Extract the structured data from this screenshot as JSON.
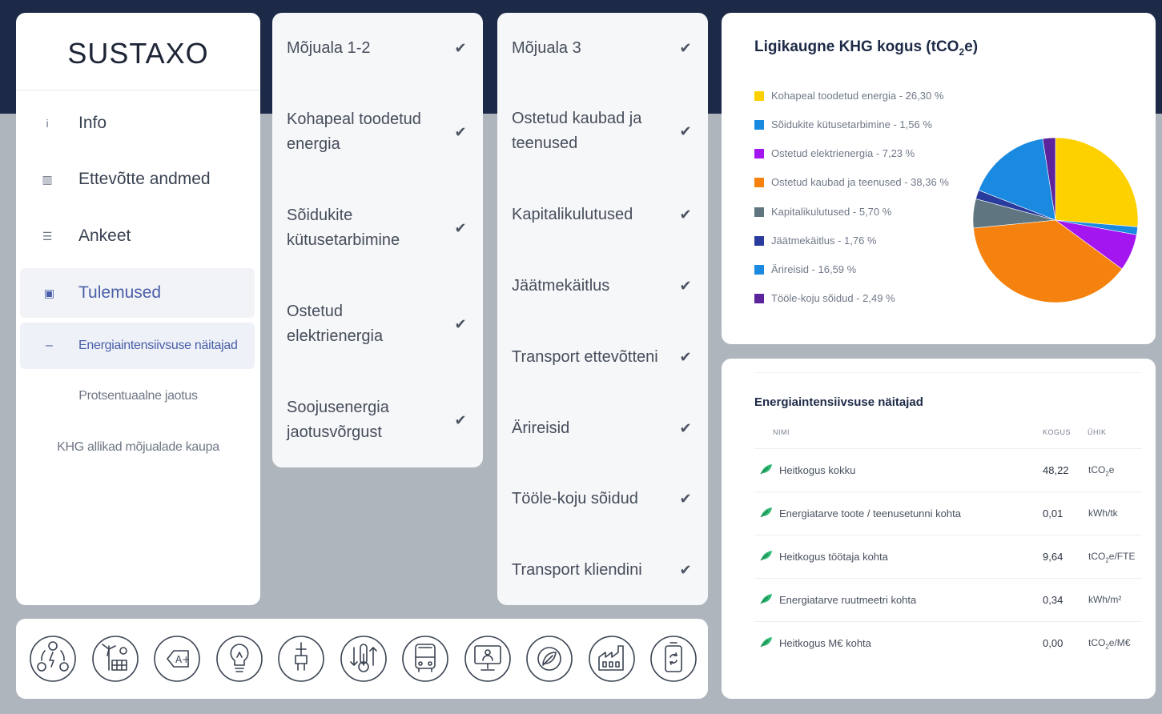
{
  "brand": {
    "logo": "SUSTAXO"
  },
  "sidebar": {
    "items": [
      {
        "label": "Info",
        "icon": "info-icon",
        "glyph": "i"
      },
      {
        "label": "Ettevõtte andmed",
        "icon": "building-icon",
        "glyph": "▥"
      },
      {
        "label": "Ankeet",
        "icon": "list-icon",
        "glyph": "☰"
      },
      {
        "label": "Tulemused",
        "icon": "chart-icon",
        "glyph": "▣"
      }
    ],
    "subitems": [
      {
        "label": "Energiaintensiivsuse näitajad",
        "marker": "–"
      },
      {
        "label": "Protsentuaalne jaotus"
      },
      {
        "label": "KHG allikad mõjualade kaupa"
      }
    ]
  },
  "scope12": {
    "header": "Mõjuala 1-2",
    "items": [
      {
        "line1": "Kohapeal toodetud",
        "line2": "energia"
      },
      {
        "line1": "Sõidukite",
        "line2": "kütusetarbimine"
      },
      {
        "line1": "Ostetud",
        "line2": "elektrienergia"
      },
      {
        "line1": "Soojusenergia",
        "line2": "jaotusvõrgust"
      }
    ]
  },
  "scope3": {
    "header": "Mõjuala 3",
    "items": [
      {
        "line1": "Ostetud kaubad ja",
        "line2": "teenused"
      },
      {
        "line1": "Kapitalikulutused",
        "line2": ""
      },
      {
        "line1": "Jäätmekäitlus",
        "line2": ""
      },
      {
        "line1": "Transport ettevõtteni",
        "line2": ""
      },
      {
        "line1": "Ärireisid",
        "line2": ""
      },
      {
        "line1": "Tööle-koju sõidud",
        "line2": ""
      },
      {
        "line1": "Transport kliendini",
        "line2": ""
      }
    ]
  },
  "check_glyph": "✔",
  "pie": {
    "title_main": "Ligikaugne KHG kogus (tCO",
    "title_sub": "2",
    "title_end": "e)",
    "legend": [
      {
        "label": "Kohapeal toodetud energia - 26,30 %",
        "color": "#fdd100"
      },
      {
        "label": "Sõidukite kütusetarbimine - 1,56 %",
        "color": "#1a8ae0"
      },
      {
        "label": "Ostetud elektrienergia - 7,23 %",
        "color": "#a416f0"
      },
      {
        "label": "Ostetud kaubad ja teenused - 38,36 %",
        "color": "#f5820e"
      },
      {
        "label": "Kapitalikulutused - 5,70 %",
        "color": "#5f7580"
      },
      {
        "label": "Jäätmekäitlus - 1,76 %",
        "color": "#293b9c"
      },
      {
        "label": "Ärireisid - 16,59 %",
        "color": "#1a8ae0"
      },
      {
        "label": "Tööle-koju sõidud - 2,49 %",
        "color": "#5b239c"
      }
    ]
  },
  "chart_data": {
    "type": "pie",
    "title": "Ligikaugne KHG kogus (tCO2e)",
    "categories": [
      "Kohapeal toodetud energia",
      "Sõidukite kütusetarbimine",
      "Ostetud elektrienergia",
      "Ostetud kaubad ja teenused",
      "Kapitalikulutused",
      "Jäätmekäitlus",
      "Ärireisid",
      "Tööle-koju sõidud"
    ],
    "values": [
      26.3,
      1.56,
      7.23,
      38.36,
      5.7,
      1.76,
      16.59,
      2.49
    ],
    "colors": [
      "#fdd100",
      "#1a8ae0",
      "#a416f0",
      "#f5820e",
      "#5f7580",
      "#293b9c",
      "#1a8ae0",
      "#5b239c"
    ],
    "legend": "left"
  },
  "table": {
    "title": "Energiaintensiivsuse näitajad",
    "headers": {
      "name": "NIMI",
      "qty": "KOGUS",
      "unit": "ÜHIK"
    },
    "rows": [
      {
        "name": "Heitkogus kokku",
        "qty": "48,22",
        "unit_a": "tCO",
        "unit_sub": "2",
        "unit_b": "e"
      },
      {
        "name": "Energiatarve toote / teenusetunni kohta",
        "qty": "0,01",
        "unit_a": "kWh/tk",
        "unit_sub": "",
        "unit_b": ""
      },
      {
        "name": "Heitkogus töötaja kohta",
        "qty": "9,64",
        "unit_a": "tCO",
        "unit_sub": "2",
        "unit_b": "e/FTE"
      },
      {
        "name": "Energiatarve ruutmeetri kohta",
        "qty": "0,34",
        "unit_a": "kWh/m²",
        "unit_sub": "",
        "unit_b": ""
      },
      {
        "name": "Heitkogus M€ kohta",
        "qty": "0,00",
        "unit_a": "tCO",
        "unit_sub": "2",
        "unit_b": "e/M€"
      }
    ]
  },
  "iconbar": {
    "icons": [
      "energy-cycle-icon",
      "wind-solar-icon",
      "energy-label-icon",
      "lightbulb-icon",
      "plug-icon",
      "thermometer-icon",
      "bus-icon",
      "monitor-person-icon",
      "leaf-badge-icon",
      "factory-icon",
      "battery-cycle-icon"
    ]
  }
}
